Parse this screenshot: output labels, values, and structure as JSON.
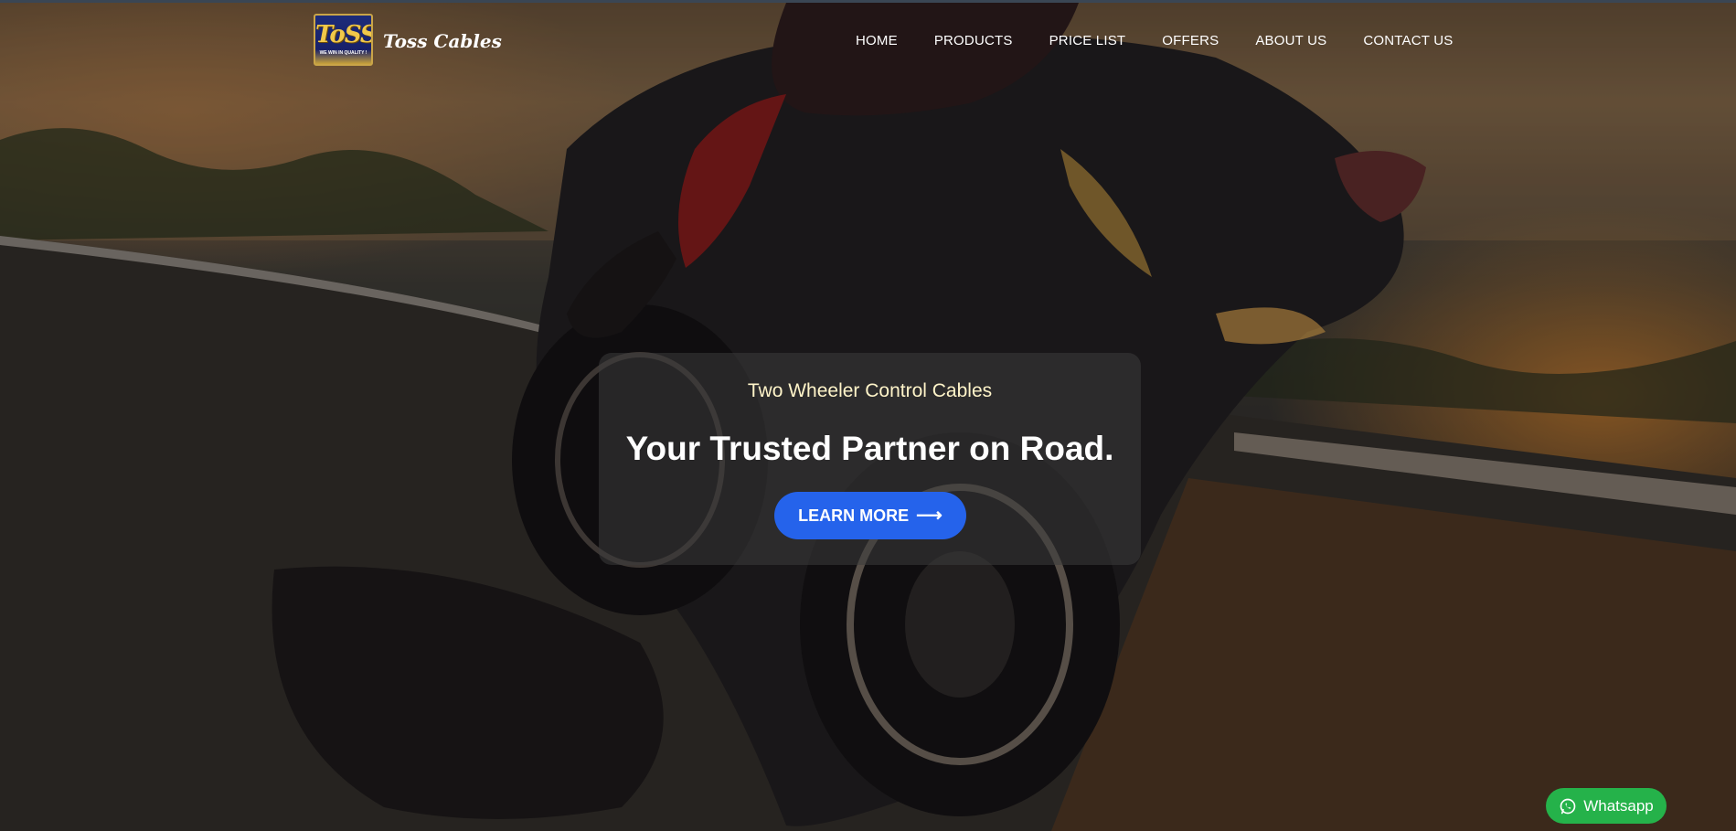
{
  "brand": {
    "logo_mark": "ToSS",
    "logo_tagline": "WE WIN IN QUALITY !",
    "name": "Toss Cables"
  },
  "nav": {
    "items": [
      {
        "label": "HOME"
      },
      {
        "label": "PRODUCTS"
      },
      {
        "label": "PRICE LIST"
      },
      {
        "label": "OFFERS"
      },
      {
        "label": "ABOUT US"
      },
      {
        "label": "CONTACT US"
      }
    ]
  },
  "hero": {
    "subtitle": "Two Wheeler Control Cables",
    "title": "Your Trusted Partner on Road.",
    "cta_label": "LEARN MORE",
    "cta_icon": "arrow-right-icon",
    "background": "motorcycle-racing-photo"
  },
  "whatsapp": {
    "label": "Whatsapp",
    "icon": "whatsapp-icon",
    "color": "#25b24a"
  },
  "colors": {
    "accent": "#2563eb",
    "text": "#ffffff",
    "subtitle": "#fff4c9"
  }
}
